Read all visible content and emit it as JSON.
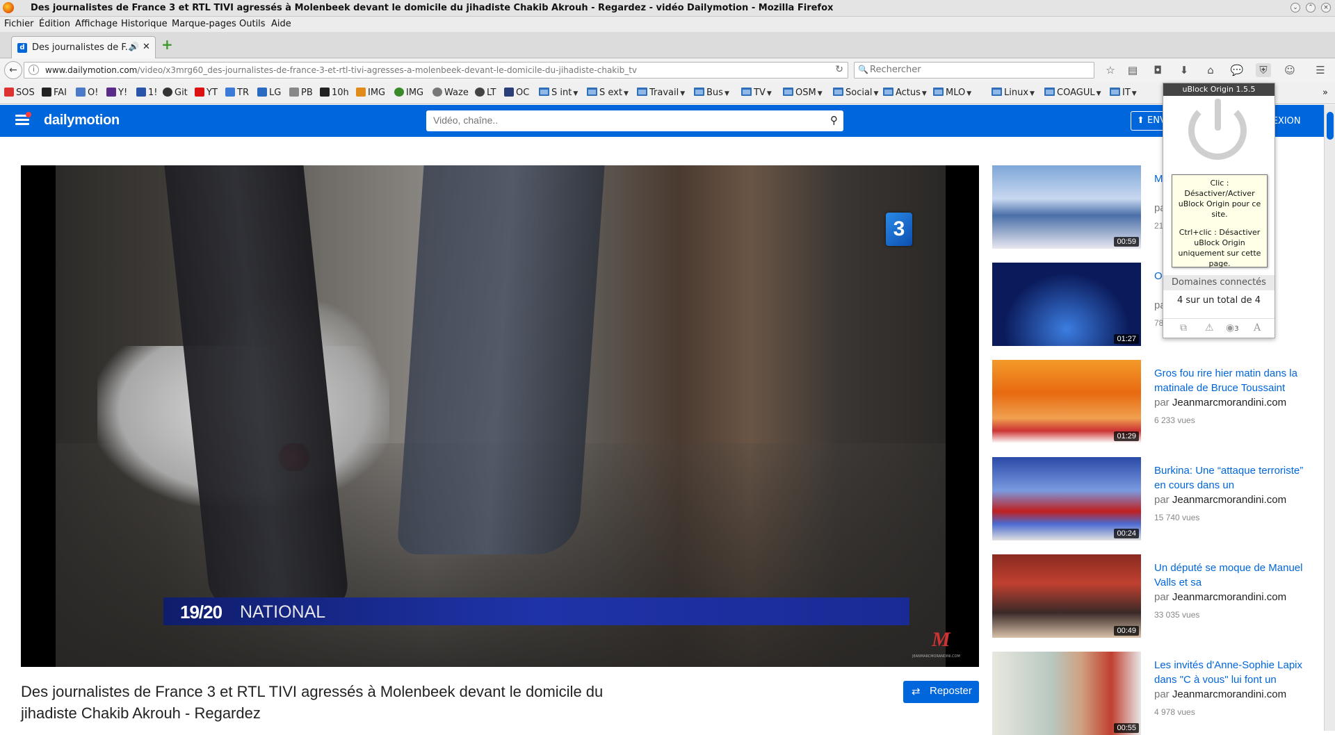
{
  "window": {
    "title": "Des journalistes de France 3 et RTL TIVI agressés à Molenbeek devant le domicile du jihadiste Chakib Akrouh - Regardez - vidéo Dailymotion - Mozilla Firefox"
  },
  "menu": [
    "Fichier",
    "Édition",
    "Affichage",
    "Historique",
    "Marque-pages",
    "Outils",
    "Aide"
  ],
  "tab": {
    "label": "Des journalistes de F...",
    "favicon": "d"
  },
  "navbar": {
    "url_domain": "www.dailymotion.com",
    "url_path": "/video/x3mrg60_des-journalistes-de-france-3-et-rtl-tivi-agresses-a-molenbeek-devant-le-domicile-du-jihadiste-chakib_tv",
    "search_placeholder": "Rechercher"
  },
  "bookmarks": [
    {
      "label": "SOS",
      "icon": "#d33"
    },
    {
      "label": "FAI",
      "icon": "#222"
    },
    {
      "label": "O!",
      "icon": "#4a7ac9"
    },
    {
      "label": "Y!",
      "icon": "#5b2b8a"
    },
    {
      "label": "1!",
      "icon": "#2855a8"
    },
    {
      "label": "Git",
      "icon": "#333"
    },
    {
      "label": "YT",
      "icon": "#d11"
    },
    {
      "label": "TR",
      "icon": "#3b7ad6"
    },
    {
      "label": "LG",
      "icon": "#2a6bc2"
    },
    {
      "label": "PB",
      "icon": "#888"
    },
    {
      "label": "10h",
      "icon": "#222"
    },
    {
      "label": "IMG",
      "icon": "#e08b1a"
    },
    {
      "label": "IMG",
      "icon": "#3a8a2a"
    },
    {
      "label": "Waze",
      "icon": "#777"
    },
    {
      "label": "LT",
      "icon": "#444"
    },
    {
      "label": "OC",
      "icon": "#2a3f7a"
    }
  ],
  "bookmark_folders": [
    "S int",
    "S ext",
    "Travail",
    "Bus",
    "TV",
    "OSM",
    "Social",
    "Actus",
    "MLO",
    "Linux",
    "COAGUL",
    "IT"
  ],
  "dailymotion": {
    "logo": "dailymotion",
    "search_placeholder": "Vidéo, chaîne..",
    "upload_label": "ENV",
    "login_label": "NEXION"
  },
  "player": {
    "channel_logo": "3",
    "lower_third_bold": "19/20",
    "lower_third_text": "NATIONAL",
    "watermark": "M",
    "watermark_caption": "JEANMARCMORANDINI.COM"
  },
  "video": {
    "title": "Des journalistes de France 3 et RTL TIVI agressés à Molenbeek devant le domicile du jihadiste Chakib Akrouh - Regardez",
    "repost_label": "Reposter"
  },
  "related": [
    {
      "title": "M... que ...oron,",
      "by_prefix": "pa",
      "channel": "",
      "views": "21",
      "duration": "00:59",
      "thumb": "studio"
    },
    {
      "title": "O... ...se é... ...anuel",
      "by_prefix": "pa",
      "channel": "",
      "views": "78",
      "duration": "01:27",
      "thumb": "talk"
    },
    {
      "title": "Gros fou rire hier matin dans la matinale de Bruce Toussaint",
      "by_prefix": "par",
      "channel": "Jeanmarcmorandini.com",
      "views": "6 233 vues",
      "duration": "01:29",
      "thumb": "news"
    },
    {
      "title": "Burkina: Une “attaque terroriste” en cours dans un",
      "by_prefix": "par",
      "channel": "Jeanmarcmorandini.com",
      "views": "15 740 vues",
      "duration": "00:24",
      "thumb": "news2"
    },
    {
      "title": "Un député se moque de Manuel Valls et sa",
      "by_prefix": "par",
      "channel": "Jeanmarcmorandini.com",
      "views": "33 035 vues",
      "duration": "00:49",
      "thumb": "assembly"
    },
    {
      "title": "Les invités d'Anne-Sophie Lapix dans \"C à vous\" lui font un",
      "by_prefix": "par",
      "channel": "Jeanmarcmorandini.com",
      "views": "4 978 vues",
      "duration": "00:55",
      "thumb": "guests"
    }
  ],
  "ublock": {
    "header": "uBlock Origin 1.5.5",
    "tooltip_line1": "Clic : Désactiver/Activer uBlock Origin pour ce site.",
    "tooltip_line2": "Ctrl+clic : Désactiver uBlock Origin uniquement sur cette page.",
    "domains_label": "Domaines connectés",
    "domains_count": "4 sur un total de 4",
    "tool_badge": "3"
  }
}
